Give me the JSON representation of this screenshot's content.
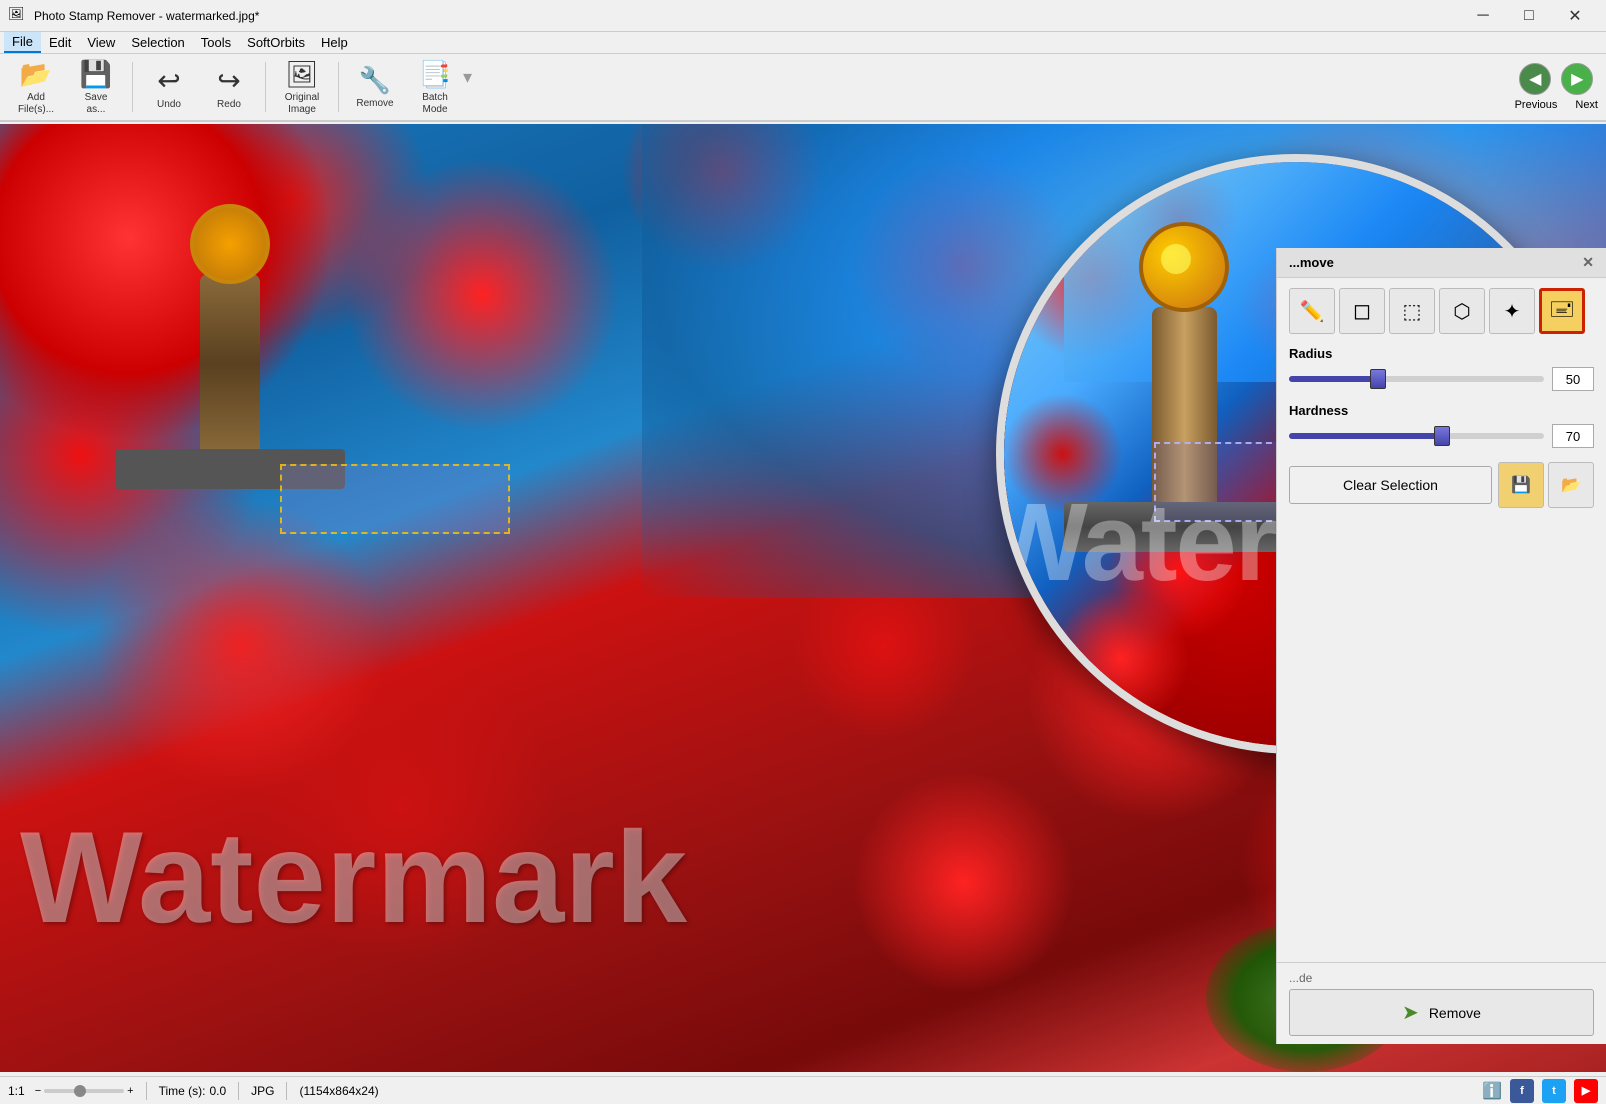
{
  "app": {
    "title": "Photo Stamp Remover - watermarked.jpg*",
    "icon": "🖼"
  },
  "titlebar": {
    "minimize_label": "─",
    "maximize_label": "□",
    "close_label": "✕"
  },
  "menubar": {
    "items": [
      "File",
      "Edit",
      "View",
      "Selection",
      "Tools",
      "SoftOrbits",
      "Help"
    ]
  },
  "toolbar": {
    "buttons": [
      {
        "id": "add-files",
        "icon": "📂",
        "label": "Add\nFile(s)..."
      },
      {
        "id": "save-as",
        "icon": "💾",
        "label": "Save\nas..."
      },
      {
        "id": "undo",
        "icon": "↩",
        "label": "Undo"
      },
      {
        "id": "redo",
        "icon": "↪",
        "label": "Redo"
      },
      {
        "id": "original-image",
        "icon": "🖼",
        "label": "Original\nImage"
      },
      {
        "id": "remove",
        "icon": "🔧",
        "label": "Remove"
      },
      {
        "id": "batch-mode",
        "icon": "📑",
        "label": "Batch\nMode"
      }
    ]
  },
  "nav": {
    "previous_label": "Previous",
    "next_label": "Next"
  },
  "panel": {
    "title": "...move",
    "close_label": "✕"
  },
  "tools": {
    "brush_icon": "✏",
    "eraser_icon": "◻",
    "rect_icon": "▣",
    "lasso_icon": "⬡",
    "wand_icon": "✦",
    "stamp_icon": "🖃",
    "active_tool": "stamp"
  },
  "radius": {
    "label": "Radius",
    "value": 50,
    "percent": 35
  },
  "hardness": {
    "label": "Hardness",
    "value": 70,
    "percent": 60
  },
  "clear_selection": {
    "label": "Clear Selection"
  },
  "save_buttons": {
    "save_icon": "💾",
    "load_icon": "📂"
  },
  "remove_section": {
    "mode_label": "...de",
    "remove_label": "Remove"
  },
  "statusbar": {
    "zoom": "1:1",
    "time_label": "Time (s):",
    "time_value": "0.0",
    "format": "JPG",
    "dimensions": "(1154x864x24)",
    "info_icon": "ℹ"
  },
  "watermark_text": "Watermark",
  "colors": {
    "accent_blue": "#4444aa",
    "active_tool_bg": "#f5d060",
    "active_tool_border": "#cc2200",
    "nav_prev": "#4a8a4a",
    "nav_next": "#4ab04a",
    "remove_arrow": "#4a8a2a"
  }
}
